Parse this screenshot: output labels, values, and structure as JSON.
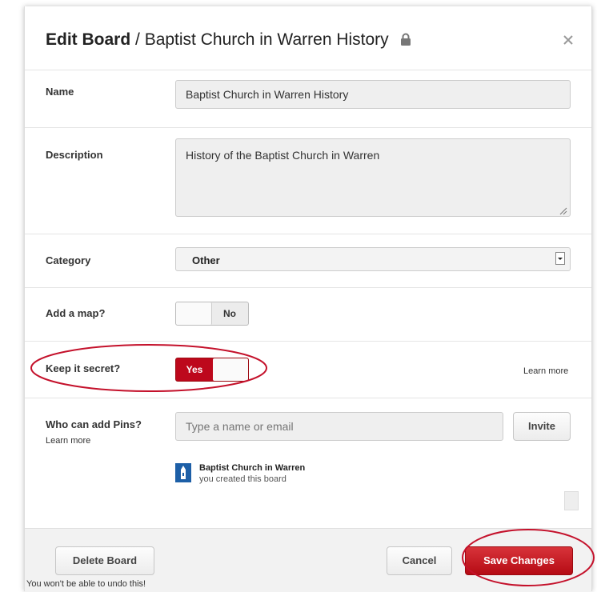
{
  "dialog": {
    "title_bold": "Edit Board",
    "title_sep": " / ",
    "title_name": "Baptist Church in Warren History"
  },
  "fields": {
    "name": {
      "label": "Name",
      "value": "Baptist Church in Warren History"
    },
    "description": {
      "label": "Description",
      "value": "History of the Baptist Church in Warren"
    },
    "category": {
      "label": "Category",
      "value": "Other"
    },
    "map": {
      "label": "Add a map?",
      "state": "No"
    },
    "secret": {
      "label": "Keep it secret?",
      "state": "Yes",
      "learn_more": "Learn more"
    },
    "collaborators": {
      "label": "Who can add Pins?",
      "learn_more": "Learn more",
      "placeholder": "Type a name or email",
      "invite_label": "Invite",
      "owner_name": "Baptist Church in Warren",
      "owner_note": "you created this board"
    }
  },
  "footer": {
    "delete_label": "Delete Board",
    "delete_warning": "You won't be able to undo this!",
    "cancel_label": "Cancel",
    "save_label": "Save Changes"
  },
  "colors": {
    "accent": "#bd081c",
    "annotation": "#c4112b"
  },
  "icons": [
    "lock-icon",
    "close-icon",
    "resize-grip-icon",
    "dropdown-arrow-icon",
    "church-avatar-icon"
  ]
}
